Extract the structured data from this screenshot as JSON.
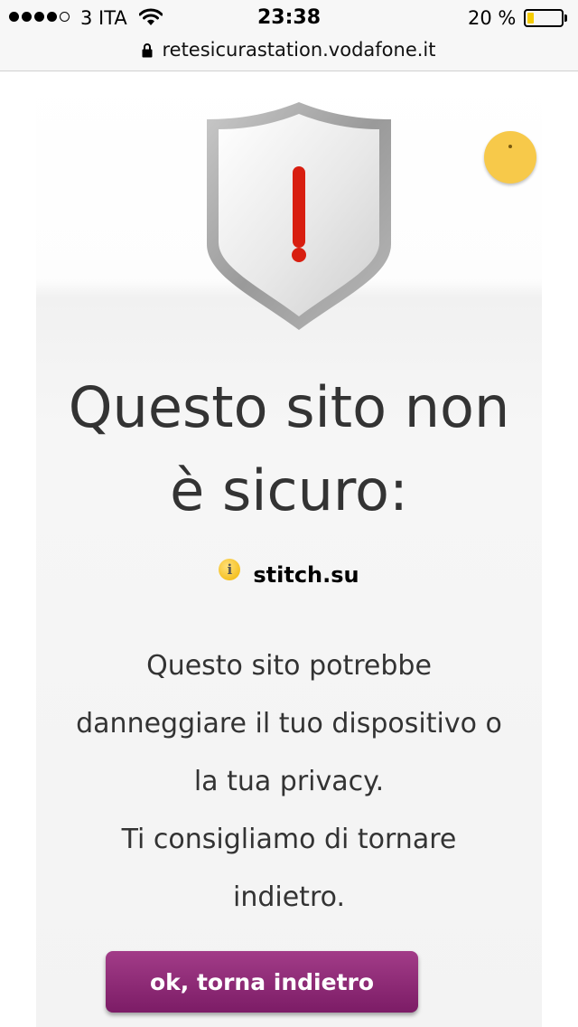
{
  "status_bar": {
    "signal_bars_filled": 4,
    "signal_bars_total": 5,
    "carrier": "3 ITA",
    "time": "23:38",
    "battery_percent": "20 %",
    "battery_level": 0.2,
    "battery_color": "#f5cc00",
    "icons": [
      "wifi-icon",
      "battery-icon"
    ]
  },
  "url_bar": {
    "url": "retesicurastation.vodafone.it",
    "icon": "lock-icon"
  },
  "warning": {
    "shield_icon": "shield-exclamation-icon",
    "help_icon": "help-icon",
    "title_line_1": "Questo sito non",
    "title_line_2": "è sicuro:",
    "site_icon": "info-icon",
    "site_name": "stitch.su",
    "message_line_1": "Questo sito potrebbe",
    "message_line_2": "danneggiare il tuo dispositivo o",
    "message_line_3": "la tua privacy.",
    "message_line_4": "Ti consigliamo di tornare",
    "message_line_5": "indietro."
  },
  "actions": {
    "back_label": "ok, torna indietro",
    "back_color": "#8e2a78"
  }
}
